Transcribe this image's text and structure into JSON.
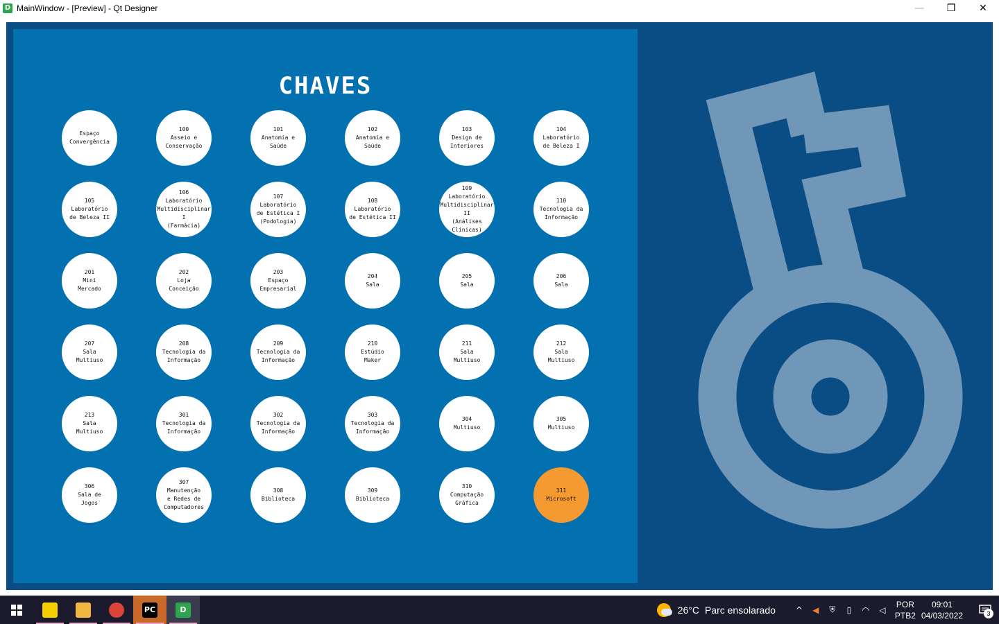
{
  "window": {
    "title": "MainWindow - [Preview] - Qt Designer",
    "app_icon_letter": "D",
    "minimize": "—",
    "restore": "❐",
    "close": "✕"
  },
  "panel": {
    "title": "CHAVES"
  },
  "keys": [
    "Espaço\nConvergência",
    "100\nAsseio e\nConservação",
    "101\nAnatomia e\nSaúde",
    "102\nAnatomia e\nSaúde",
    "103\nDesign de\nInteriores",
    "104\nLaboratório\nde Beleza I",
    "105\nLaboratório\nde Beleza II",
    "106\nLaboratório\nMultidisciplinar I\n(Farmácia)",
    "107\nLaboratório\nde Estética I\n(Podologia)",
    "108\nLaboratório\nde Estética II",
    "109\nLaboratório\nMultidisciplinar II\n(Análises\nClínicas)",
    "110\nTecnologia da\nInformação",
    "201\nMini\nMercado",
    "202\nLoja\nConceição",
    "203\nEspaço\nEmpresarial",
    "204\nSala",
    "205\nSala",
    "206\nSala",
    "207\nSala\nMultiuso",
    "208\nTecnologia da\nInformação",
    "209\nTecnologia da\nInformação",
    "210\nEstúdio\nMaker",
    "211\nSala\nMultiuso",
    "212\nSala\nMultiuso",
    "213\nSala\nMultiuso",
    "301\nTecnologia da\nInformação",
    "302\nTecnologia da\nInformação",
    "303\nTecnologia da\nInformação",
    "304\nMultiuso",
    "305\nMultiuso",
    "306\nSala de\nJogos",
    "307\nManutenção\ne Redes de\nComputadores",
    "308\nBiblioteca",
    "309\nBiblioteca",
    "310\nComputação\nGráfica",
    "311\nMicrosoft"
  ],
  "active_key_index": 35,
  "colors": {
    "window_bg": "#0a4d85",
    "panel_bg": "#0370b0",
    "button_bg": "#ffffff",
    "active_button_bg": "#f59a30",
    "logo": "#7096b8"
  },
  "taskbar": {
    "apps": [
      {
        "name": "sticky-notes",
        "label": "",
        "color": "#f5d000"
      },
      {
        "name": "file-explorer",
        "label": "",
        "color": "#f0b640"
      },
      {
        "name": "chrome",
        "label": "",
        "color": "#db4437"
      },
      {
        "name": "pycharm",
        "label": "PC",
        "color": "#21d789"
      },
      {
        "name": "qt-designer",
        "label": "D",
        "color": "#2da44e"
      }
    ],
    "weather_temp": "26°C",
    "weather_text": "Parc ensolarado",
    "lang_1": "POR",
    "lang_2": "PTB2",
    "time": "09:01",
    "date": "04/03/2022",
    "notifications": "3"
  }
}
